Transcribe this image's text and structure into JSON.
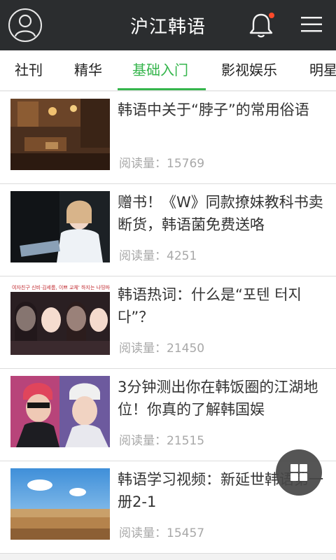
{
  "app": {
    "title": "沪江韩语"
  },
  "icons": {
    "avatar": "user-avatar-icon",
    "notifications": "bell-icon",
    "menu": "hamburger-menu-icon",
    "fab": "grid-icon"
  },
  "colors": {
    "topbar": "#2b2d2f",
    "accent": "#35b54c",
    "badge": "#ff4a2a"
  },
  "tabs": [
    {
      "label": "社刊",
      "active": false
    },
    {
      "label": "精华",
      "active": false
    },
    {
      "label": "基础入门",
      "active": true
    },
    {
      "label": "影视娱乐",
      "active": false
    },
    {
      "label": "明星",
      "active": false
    }
  ],
  "articles": [
    {
      "title": "韩语中关于“脖子”的常用俗语",
      "read_label": "阅读量：",
      "read_count": "15769"
    },
    {
      "title": "赠书！《W》同款撩妹教科书卖断货，韩语菌免费送咯",
      "read_label": "阅读量：",
      "read_count": "4251"
    },
    {
      "title": "韩语热词：什么是“포텐 터지다”？",
      "read_label": "阅读量：",
      "read_count": "21450"
    },
    {
      "title": "3分钟测出你在韩饭圈的江湖地位！你真的了解韩国娱",
      "read_label": "阅读量：",
      "read_count": "21515"
    },
    {
      "title": "韩语学习视频：新延世韩语第一册2-1",
      "read_label": "阅读量：",
      "read_count": "15457"
    }
  ],
  "thumb_caption": "여자친구 신비·김세롬, 이쁘 교체' 하지는 나띵파라"
}
